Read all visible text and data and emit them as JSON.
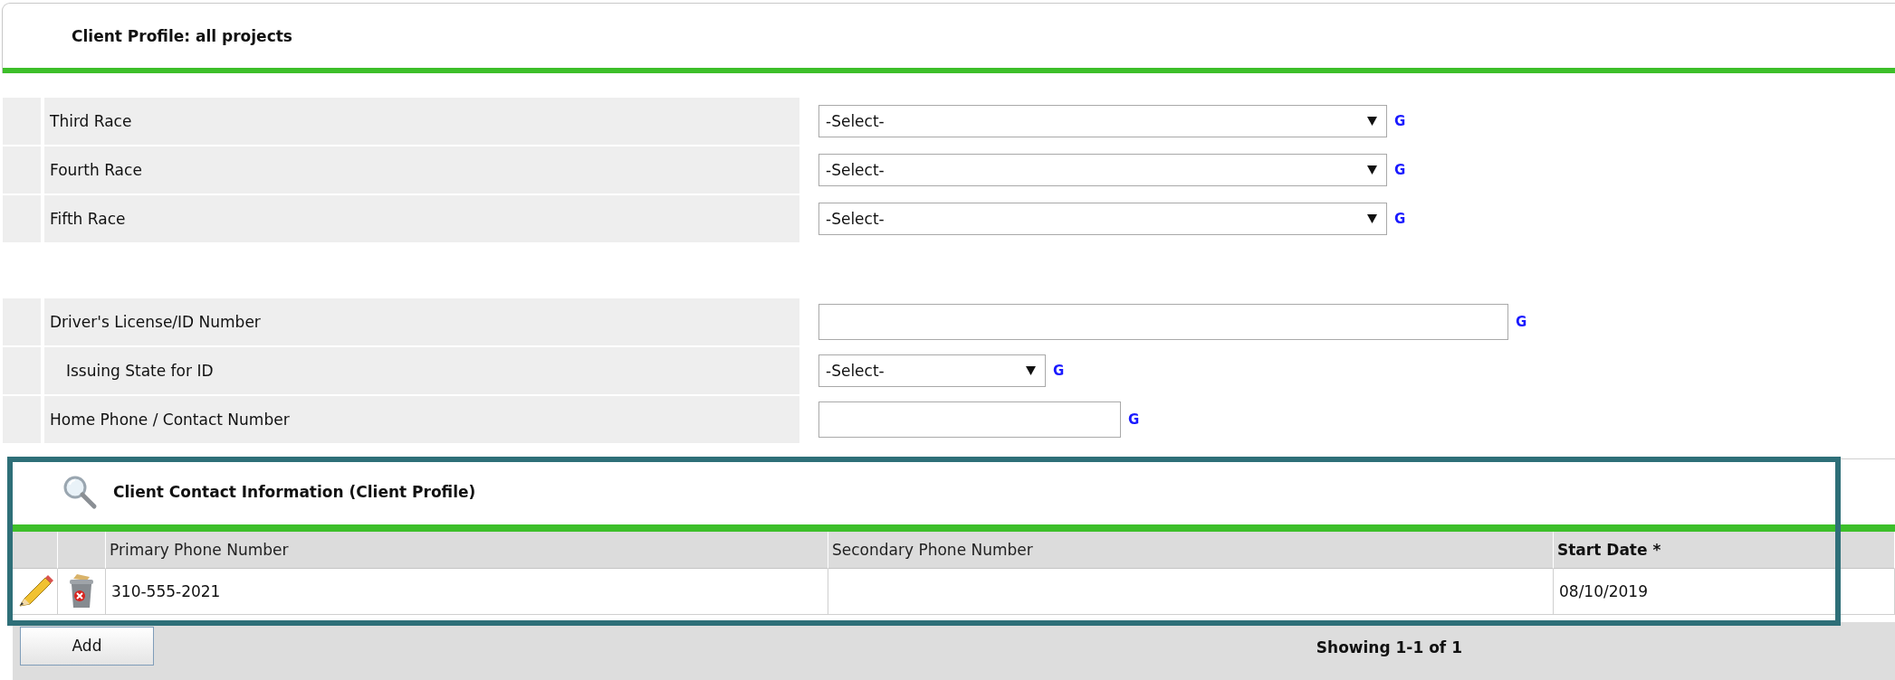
{
  "header": {
    "title": "Client Profile: all projects"
  },
  "groups": [
    [
      {
        "label": "Third Race",
        "kind": "select-wide",
        "value": "-Select-",
        "indented": false,
        "help": "G"
      },
      {
        "label": "Fourth Race",
        "kind": "select-wide",
        "value": "-Select-",
        "indented": false,
        "help": "G"
      },
      {
        "label": "Fifth Race",
        "kind": "select-wide",
        "value": "-Select-",
        "indented": false,
        "help": "G"
      }
    ],
    [
      {
        "label": "Driver's License/ID Number",
        "kind": "text-wide",
        "indented": false,
        "help": "G"
      },
      {
        "label": "Issuing State for ID",
        "kind": "select-narrow",
        "value": "-Select-",
        "indented": true,
        "help": "G"
      },
      {
        "label": "Home Phone / Contact Number",
        "kind": "text-narrow",
        "indented": false,
        "help": "G"
      }
    ]
  ],
  "section": {
    "title": "Client Contact Information (Client Profile)",
    "columns": [
      {
        "label": "Primary Phone Number",
        "required": false
      },
      {
        "label": "Secondary Phone Number",
        "required": false
      },
      {
        "label": "Start Date",
        "required": true,
        "required_mark": "*"
      }
    ],
    "rows": [
      {
        "cells": [
          "310-555-2021",
          null,
          "08/10/2019"
        ]
      }
    ],
    "add_button": "Add",
    "pagination": "Showing 1-1 of 1"
  }
}
